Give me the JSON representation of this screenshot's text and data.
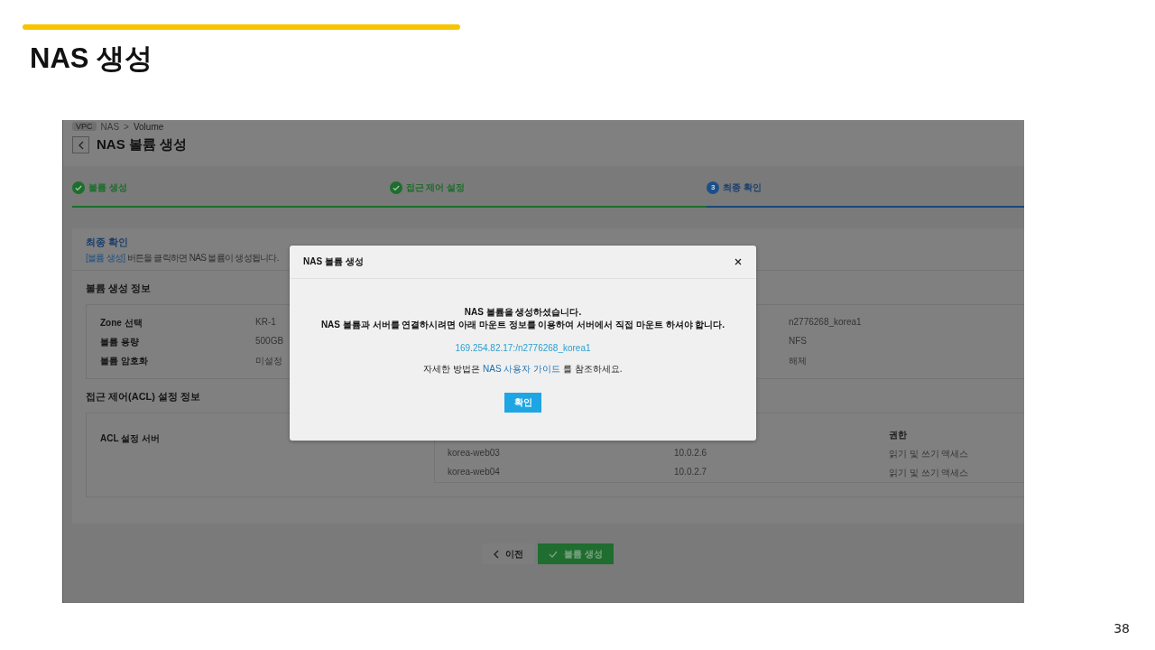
{
  "slide": {
    "title": "NAS 생성",
    "page_number": "38"
  },
  "console": {
    "breadcrumb": {
      "badge": "VPC",
      "items": [
        "NAS",
        "Volume"
      ],
      "separator": ">"
    },
    "page_title": "NAS 볼륨 생성",
    "steps": [
      {
        "label": "볼륨 생성",
        "kind": "done"
      },
      {
        "label": "접근 제어 설정",
        "kind": "done"
      },
      {
        "number": "3",
        "label": "최종 확인",
        "kind": "current"
      }
    ],
    "summary": {
      "title": "최종 확인",
      "highlight": "[볼륨 생성]",
      "description": "버튼을 클릭하면 NAS 볼륨이 생성됩니다."
    },
    "volume_info": {
      "title": "볼륨 생성 정보",
      "rows": [
        {
          "label": "Zone 선택",
          "value": "KR-1",
          "column_3": "n2776268_korea1"
        },
        {
          "label": "볼륨 용량",
          "value": "500GB",
          "column_3": "NFS"
        },
        {
          "label": "볼륨 암호화",
          "value": "미설정",
          "column_3": "해제"
        }
      ]
    },
    "acl_info": {
      "title": "접근 제어(ACL) 설정 정보",
      "label": "ACL 설정 서버",
      "table": {
        "columns": {
          "column_3": "권한"
        },
        "rows": [
          {
            "column_1": "korea-web03",
            "column_2": "10.0.2.6",
            "column_3": "읽기 및 쓰기 액세스"
          },
          {
            "column_1": "korea-web04",
            "column_2": "10.0.2.7",
            "column_3": "읽기 및 쓰기 액세스"
          }
        ]
      }
    },
    "buttons": [
      {
        "label": "이전",
        "kind": "back"
      },
      {
        "label": "볼륨 생성",
        "kind": "primary"
      }
    ]
  },
  "dialog": {
    "title": "NAS 볼륨 생성",
    "message": [
      "NAS 볼륨을 생성하셨습니다.",
      "NAS 볼륨과 서버를 연결하시려면 아래 마운트 정보를 이용하여 서버에서 직접 마운트 하셔야 합니다."
    ],
    "mount_path": "169.254.82.17:/n2776268_korea1",
    "guide": {
      "before": "자세한 방법은",
      "link": "NAS 사용자 가이드",
      "after": "를 참조하세요."
    },
    "confirm": "확인"
  }
}
